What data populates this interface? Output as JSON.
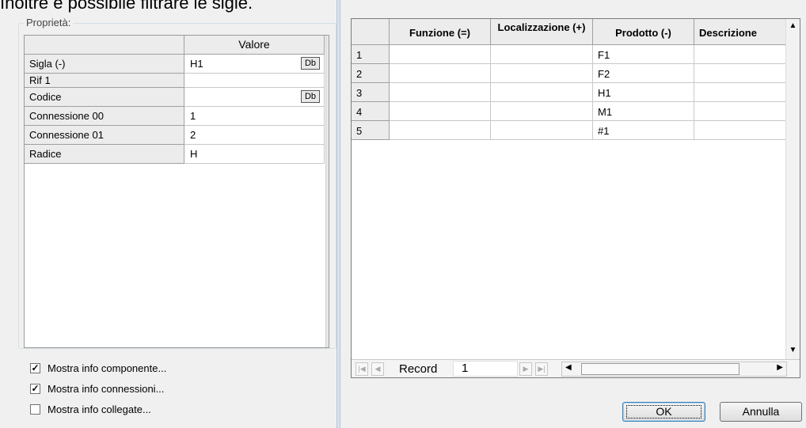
{
  "caption_text": "Inoltre è possibile filtrare le sigle.",
  "properties": {
    "legend": "Proprietà:",
    "header_value": "Valore",
    "db_label": "Db",
    "rows": [
      {
        "name": "Sigla (-)",
        "value": "H1"
      },
      {
        "name": "Rif 1",
        "value": ""
      },
      {
        "name": "Codice",
        "value": ""
      },
      {
        "name": "Connessione 00",
        "value": "1"
      },
      {
        "name": "Connessione 01",
        "value": "2"
      },
      {
        "name": "Radice",
        "value": "H"
      }
    ]
  },
  "checkboxes": [
    {
      "label": "Mostra info componente...",
      "checked": true
    },
    {
      "label": "Mostra info connessioni...",
      "checked": true
    },
    {
      "label": "Mostra info collegate...",
      "checked": false
    }
  ],
  "grid": {
    "columns": [
      "Funzione (=)",
      "Localizzazione (+)",
      "Prodotto (-)",
      "Descrizione"
    ],
    "rows": [
      {
        "n": "1",
        "funzione": "",
        "localizzazione": "",
        "prodotto": "F1",
        "descrizione": ""
      },
      {
        "n": "2",
        "funzione": "",
        "localizzazione": "",
        "prodotto": "F2",
        "descrizione": ""
      },
      {
        "n": "3",
        "funzione": "",
        "localizzazione": "",
        "prodotto": "H1",
        "descrizione": ""
      },
      {
        "n": "4",
        "funzione": "",
        "localizzazione": "",
        "prodotto": "M1",
        "descrizione": ""
      },
      {
        "n": "5",
        "funzione": "",
        "localizzazione": "",
        "prodotto": "#1",
        "descrizione": ""
      }
    ],
    "record_label": "Record",
    "record_value": "1"
  },
  "buttons": {
    "ok": "OK",
    "cancel": "Annulla"
  }
}
